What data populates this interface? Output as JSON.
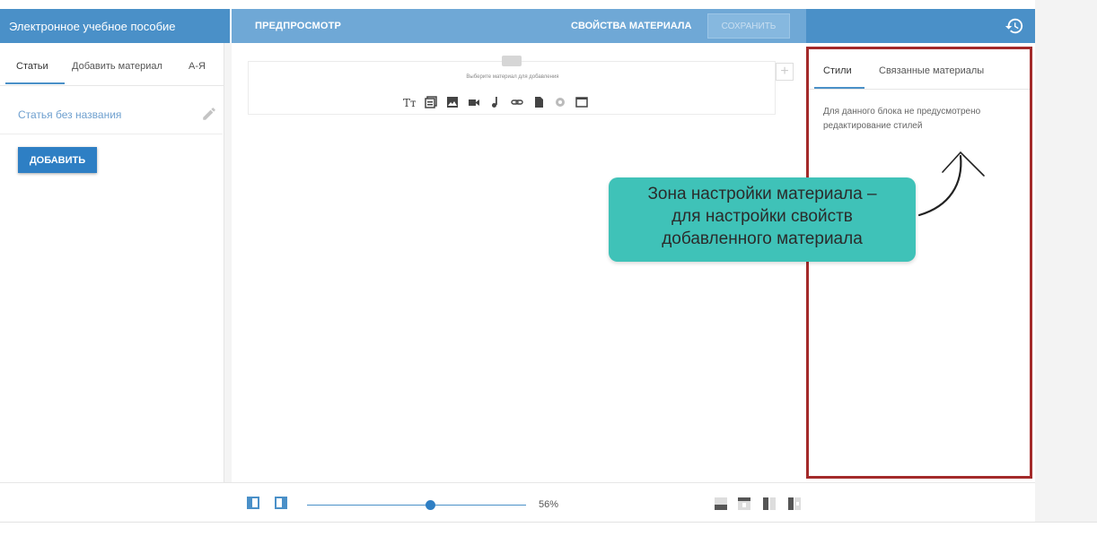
{
  "header": {
    "app_title": "Электронное учебное пособие",
    "preview_label": "ПРЕДПРОСМОТР",
    "properties_label": "СВОЙСТВА МАТЕРИАЛА",
    "save_label": "СОХРАНИТЬ",
    "history_icon": "history-icon"
  },
  "left_panel": {
    "tabs": [
      {
        "label": "Статьи"
      },
      {
        "label": "Добавить материал"
      },
      {
        "label": "А-Я"
      }
    ],
    "article_title": "Статья без названия",
    "add_button": "ДОБАВИТЬ"
  },
  "editor": {
    "block_hint": "Выберите материал для добавления",
    "material_icons": [
      "text-icon",
      "gallery-icon",
      "image-icon",
      "video-icon",
      "audio-icon",
      "link-icon",
      "file-icon",
      "widget-icon",
      "frame-icon"
    ]
  },
  "right_panel": {
    "tabs": [
      {
        "label": "Стили"
      },
      {
        "label": "Связанные материалы"
      }
    ],
    "message": "Для данного блока не предусмотрено редактирование стилей"
  },
  "callout": {
    "lines": [
      "Зона настройки материала –",
      "для настройки свойств",
      "добавленного материала"
    ],
    "color": "#3fc2b8"
  },
  "bottom": {
    "zoom": "56%",
    "zoom_value": 0.56
  },
  "colors": {
    "brand": "#4a90c8",
    "highlight_border": "#a32a2a"
  }
}
